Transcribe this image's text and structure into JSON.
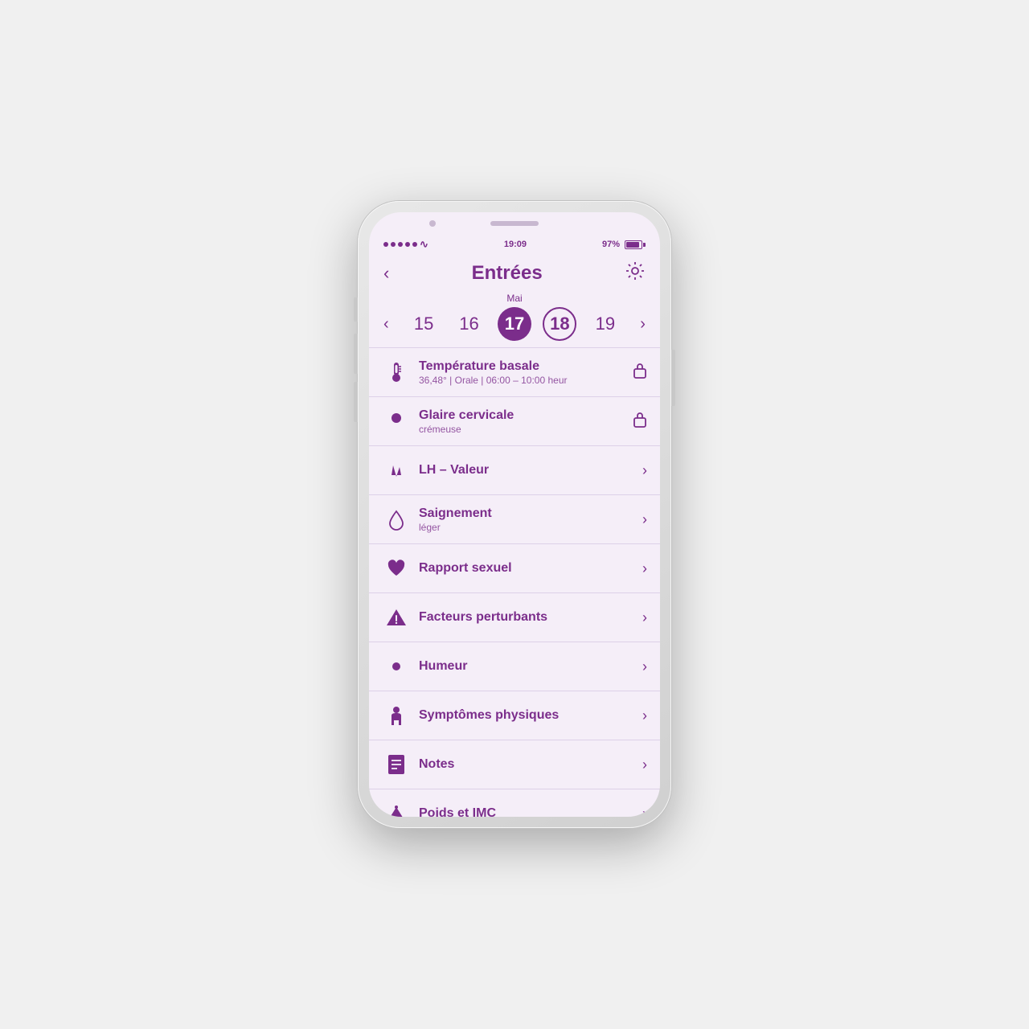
{
  "status_bar": {
    "time": "19:09",
    "battery_percent": "97%"
  },
  "header": {
    "title": "Entrées",
    "back_label": "‹",
    "settings_label": "⚙"
  },
  "date_nav": {
    "month": "Mai",
    "dates": [
      "15",
      "16",
      "17",
      "18",
      "19"
    ],
    "selected_filled": "17",
    "selected_outline": "18",
    "prev_arrow": "‹",
    "next_arrow": "›"
  },
  "menu_items": [
    {
      "id": "temperature",
      "label": "Température basale",
      "sublabel": "36,48° | Orale | 06:00 – 10:00 heur",
      "icon_type": "thermometer",
      "right_type": "lock"
    },
    {
      "id": "glaire",
      "label": "Glaire cervicale",
      "sublabel": "crémeuse",
      "icon_type": "peace",
      "right_type": "lock"
    },
    {
      "id": "lh",
      "label": "LH – Valeur",
      "sublabel": "",
      "icon_type": "wave",
      "right_type": "chevron"
    },
    {
      "id": "saignement",
      "label": "Saignement",
      "sublabel": "léger",
      "icon_type": "drop",
      "right_type": "chevron"
    },
    {
      "id": "rapport",
      "label": "Rapport sexuel",
      "sublabel": "",
      "icon_type": "heart",
      "right_type": "chevron"
    },
    {
      "id": "facteurs",
      "label": "Facteurs perturbants",
      "sublabel": "",
      "icon_type": "warning",
      "right_type": "chevron"
    },
    {
      "id": "humeur",
      "label": "Humeur",
      "sublabel": "",
      "icon_type": "sun",
      "right_type": "chevron"
    },
    {
      "id": "symptomes",
      "label": "Symptômes physiques",
      "sublabel": "",
      "icon_type": "person",
      "right_type": "chevron"
    },
    {
      "id": "notes",
      "label": "Notes",
      "sublabel": "",
      "icon_type": "notes",
      "right_type": "chevron"
    },
    {
      "id": "poids",
      "label": "Poids et IMC",
      "sublabel": "",
      "icon_type": "scale",
      "right_type": "chevron"
    }
  ],
  "colors": {
    "primary": "#7b2d8b",
    "bg": "#f5eef8",
    "divider": "#ddd0e8"
  }
}
